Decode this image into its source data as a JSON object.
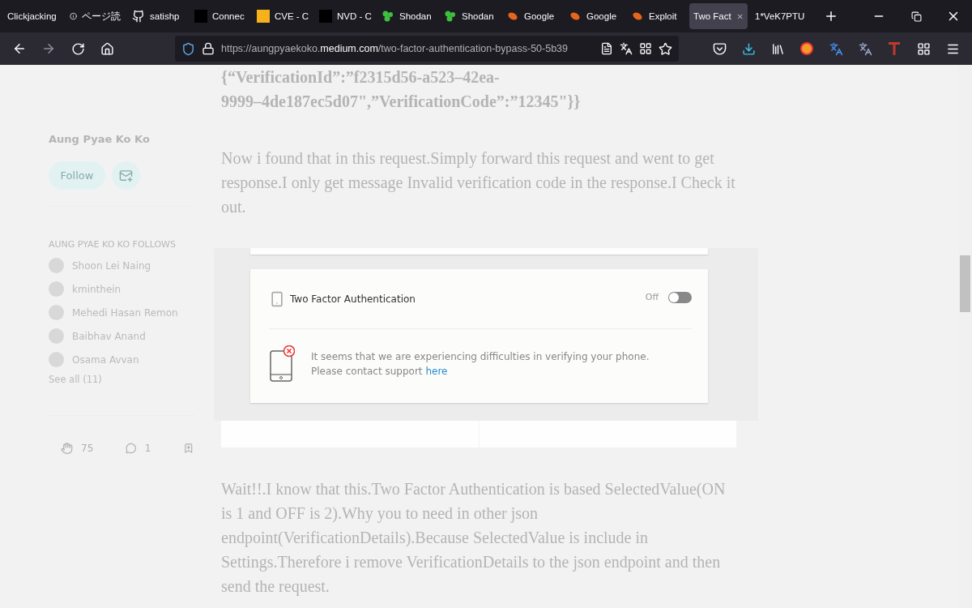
{
  "tabs": [
    {
      "title": "Clickjacking",
      "selected": false
    },
    {
      "title": "ページ読",
      "selected": false
    },
    {
      "title": "satishp",
      "selected": false
    },
    {
      "title": "Connec",
      "selected": false
    },
    {
      "title": "CVE - C",
      "selected": false
    },
    {
      "title": "NVD - C",
      "selected": false
    },
    {
      "title": "Shodan",
      "selected": false
    },
    {
      "title": "Shodan",
      "selected": false
    },
    {
      "title": "Google",
      "selected": false
    },
    {
      "title": "Google",
      "selected": false
    },
    {
      "title": "Exploit",
      "selected": false
    },
    {
      "title": "Two Fact",
      "selected": true
    },
    {
      "title": "1*VeK7PTU",
      "selected": false
    }
  ],
  "address_bar": {
    "prefix": "https://aungpyaekoko.",
    "domain": "medium.com",
    "path": "/two-factor-authentication-bypass-50-5b39"
  },
  "sidebar": {
    "author": "Aung Pyae Ko Ko",
    "follow_button": "Follow",
    "follows_heading": "AUNG PYAE KO KO FOLLOWS",
    "follows": [
      "Shoon Lei Naing",
      "kminthein",
      "Mehedi Hasan Remon",
      "Baibhav Anand",
      "Osama Avvan"
    ],
    "see_all": "See all (11)",
    "claps": "75",
    "comments": "1"
  },
  "article": {
    "code_lines": [
      "{“VerificationId”:”f2315d56-a523–42ea-",
      "9999–4de187ec5d07\",”VerificationCode”:”12345\"}}"
    ],
    "paragraph_1": "Now i found that in this request.Simply forward this request and went to get response.I only get message Invalid verification code in the response.I Check it out.",
    "image": {
      "setting_title": "Two Factor Authentication",
      "toggle_label": "Off",
      "on": false,
      "message": "It seems that we are experiencing difficulties in verifying your phone. Please contact support",
      "link": "here"
    },
    "paragraph_2": "Wait!!.I know that this.Two Factor Authentication is based SelectedValue(ON is 1 and OFF is 2).Why you to need in other json endpoint(VerificationDetails).Because SelectedValue is include in Settings.Therefore i remove VerificationDetails to the json endpoint and then send the request."
  }
}
